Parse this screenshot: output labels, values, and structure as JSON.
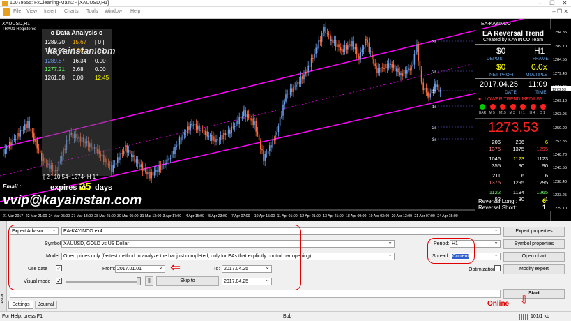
{
  "window": {
    "title": "10079555: FxCleaning-Main2 - [XAUUSD,H1]"
  },
  "menu": [
    "File",
    "View",
    "Insert",
    "Charts",
    "Tools",
    "Window",
    "Help"
  ],
  "chart": {
    "symbol_line1": "XAUUSD,H1",
    "symbol_line2": "TRX01  Registered",
    "watermark_url": "kayainstan.com",
    "email_label": "Email :",
    "email_value": "vvip@kayainstan.com",
    "expire_prefix": "expires in :",
    "expire_days": "25",
    "expire_suffix": "days",
    "bottom_label": "[ 2 ] 10.54~1274~H 1\"",
    "ea_name": "EA-KAYINCO",
    "levels_right": [
      "3r",
      "2r",
      "1r",
      "1s",
      "2s",
      "3s"
    ],
    "price_axis": [
      "1294.85",
      "1289.70",
      "1284.55",
      "1279.40",
      "1274.25",
      "1273.53",
      "1269.10",
      "1263.95",
      "1259.00",
      "1253.85",
      "1248.70",
      "1243.55",
      "1238.40",
      "1233.25",
      "1229.10"
    ],
    "time_axis": [
      "21 Mar 2017",
      "22 Mar 21:00",
      "24 Mar 05:00",
      "27 Mar 13:00",
      "28 Mar 21:00",
      "30 Mar 05:00",
      "31 Mar 13:00",
      "3 Apr 17:00",
      "4 Apr 15:00",
      "5 Apr 23:00",
      "7 Apr 07:00",
      "10 Apr 15:00",
      "11 Apr 01:00",
      "12 Apr 21:00",
      "13 Apr 21:00",
      "18 Apr 09:00",
      "19 Apr 03:00",
      "20 Apr 13:00",
      "21 Apr 07:00",
      "24 Apr 15:00"
    ],
    "colors": {
      "up": "#6a9ee8",
      "down": "#ff6a3a",
      "channel": "#ff00ff",
      "axis": "#ffffff"
    }
  },
  "data_analysis": {
    "title": "o Data Analysis o",
    "rows": [
      {
        "a": "1289.20",
        "b": "15.67",
        "c": "[ 0 ]",
        "color_b": "#ffb000",
        "color_c": "#ffffff"
      },
      {
        "a": "1265.23",
        "b": "8.30",
        "c": "[ 0 ]",
        "color_b": "#ffb000",
        "color_c": "#ffffff"
      },
      {
        "a": "1289.87",
        "b": "16.34",
        "c": "0.00",
        "color_b": "#ffffff",
        "color_c": "#ffffff",
        "color_a": "#6a9ee8"
      },
      {
        "a": "1277.21",
        "b": "3.68",
        "c": "0.00",
        "color_b": "#ffffff",
        "color_c": "#ffffff",
        "color_a": "#66ff66"
      },
      {
        "a": "1261.08",
        "b": "0.00",
        "c": "12.45",
        "color_b": "#ffffff",
        "color_c": "#ffff00"
      }
    ]
  },
  "reversal_panel": {
    "title": "EA Reversal Trend",
    "subtitle": "Created by KAYINCO Team",
    "deposit_value": "$0",
    "deposit_label": "DEPOSIT",
    "frame_value": "H1",
    "frame_label": "FRAME",
    "netprofit_value": "$0",
    "netprofit_label": "NET PROFIT",
    "multiple_value": "0.0x",
    "multiple_label": "MULTIPLE",
    "date_value": "2017.04.25",
    "date_label": "DATE",
    "time_value": "11:09",
    "time_label": "TIME",
    "trend_label": "LOWER TREND MEDIUM",
    "timeframes": [
      "BAR",
      "M 5",
      "M15",
      "M 3",
      "H 1",
      "H 4",
      "D 1"
    ],
    "dot_colors": [
      "#00cc00",
      "#ff2020",
      "#ff2020",
      "#ff2020",
      "#ff2020",
      "#ff2020",
      "#ff2020"
    ],
    "price": "1273.53",
    "grid_rows": [
      {
        "c": [
          {
            "v": "206",
            "k": "#fff"
          },
          {
            "v": "206",
            "k": "#fff"
          },
          {
            "v": "6",
            "k": "#ffff00"
          }
        ]
      },
      {
        "c": [
          {
            "v": "1375",
            "k": "#ff8080"
          },
          {
            "v": "1375",
            "k": "#fff"
          },
          {
            "v": "1295",
            "k": "#ff3030"
          }
        ]
      },
      {
        "c": [
          {
            "v": "1046",
            "k": "#fff"
          },
          {
            "v": "1123",
            "k": "#ffff00"
          },
          {
            "v": "1123",
            "k": "#fff"
          }
        ]
      },
      {
        "c": [
          {
            "v": "355",
            "k": "#fff"
          },
          {
            "v": "90",
            "k": "#fff"
          },
          {
            "v": "90",
            "k": "#fff"
          }
        ]
      },
      {
        "c": [
          {
            "v": "211",
            "k": "#fff"
          },
          {
            "v": "6",
            "k": "#fff"
          },
          {
            "v": "6",
            "k": "#fff"
          }
        ]
      },
      {
        "c": [
          {
            "v": "1375",
            "k": "#ff8080"
          },
          {
            "v": "1295",
            "k": "#fff"
          },
          {
            "v": "1295",
            "k": "#fff"
          }
        ]
      },
      {
        "c": [
          {
            "v": "1122",
            "k": "#66ff66"
          },
          {
            "v": "1194",
            "k": "#fff"
          },
          {
            "v": "1265",
            "k": "#66ff66"
          }
        ]
      },
      {
        "c": [
          {
            "v": "92",
            "k": "#fff"
          },
          {
            "v": "30",
            "k": "#fff"
          },
          {
            "v": "1",
            "k": "#fff"
          }
        ]
      }
    ],
    "long_label": "Reversal Long :",
    "long_value": "6",
    "short_label": "Reversal Short:",
    "short_value": "1"
  },
  "tester": {
    "side_label": "Tester",
    "type_value": "Expert Advisor",
    "ea_value": "EA-KAYINCO.ex4",
    "symbol_label": "Symbol:",
    "symbol_value": "XAUUSD, GOLD vs US Dollar",
    "model_label": "Model:",
    "model_value": "Open prices only (fastest method to analyze the bar just completed, only for EAs that explicitly control bar opening)",
    "usedate_label": "Use date",
    "from_label": "From:",
    "from_value": "2017.01.01",
    "to_label": "To:",
    "to_value": "2017.04.25",
    "visual_label": "Visual mode",
    "skip_label": "Skip to",
    "skip_value": "2017.04.25",
    "period_label": "Period:",
    "period_value": "H1",
    "spread_label": "Spread:",
    "spread_value": "Current",
    "optimization_label": "Optimization",
    "btn_expert_props": "Expert properties",
    "btn_symbol_props": "Symbol properties",
    "btn_open_chart": "Open chart",
    "btn_modify": "Modify expert",
    "btn_start": "Start",
    "pause_label": "||",
    "arrow_left": "⇐"
  },
  "tabs": [
    "Settings",
    "Journal"
  ],
  "annotation_online": "Online",
  "annotation_arrow": "⇩",
  "statusbar": {
    "help": "For Help, press F1",
    "middle": "Bbb",
    "traffic": "101/1 kb"
  }
}
